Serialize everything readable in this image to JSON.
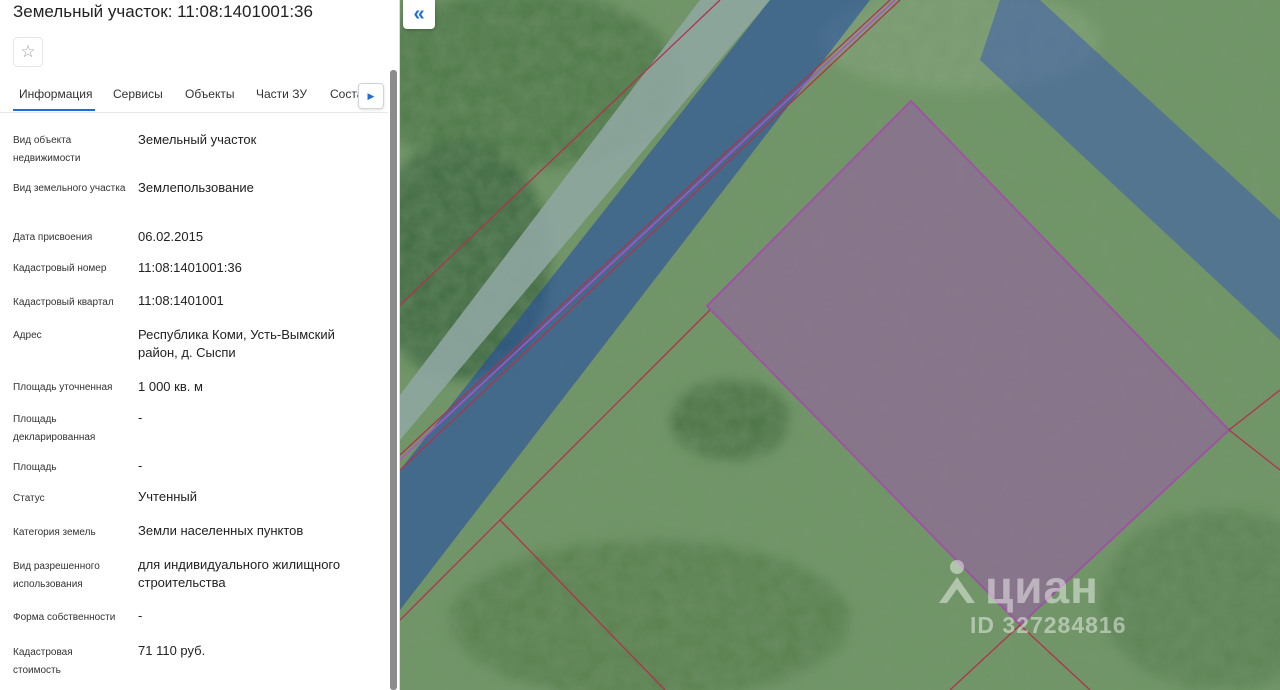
{
  "panel": {
    "title": "Земельный участок: 11:08:1401001:36",
    "favorite_icon": "star-outline-icon",
    "tabs": [
      {
        "label": "Информация",
        "active": true
      },
      {
        "label": "Сервисы",
        "active": false
      },
      {
        "label": "Объекты",
        "active": false
      },
      {
        "label": "Части ЗУ",
        "active": false
      },
      {
        "label": "Соста",
        "active": false
      }
    ],
    "tabs_next_icon": "caret-right-icon",
    "fields": [
      {
        "label": "Вид объекта недвижимости",
        "value": "Земельный участок"
      },
      {
        "label": "Вид земельного участка",
        "value": "Землепользование"
      },
      {
        "label": "Дата присвоения",
        "value": "06.02.2015"
      },
      {
        "label": "Кадастровый номер",
        "value": "11:08:1401001:36"
      },
      {
        "label": "Кадастровый квартал",
        "value": "11:08:1401001"
      },
      {
        "label": "Адрес",
        "value": "Республика Коми, Усть-Вымский район, д. Сыспи"
      },
      {
        "label": "Площадь уточненная",
        "value": "1 000 кв. м"
      },
      {
        "label": "Площадь декларированная",
        "value": "-"
      },
      {
        "label": "Площадь",
        "value": "-"
      },
      {
        "label": "Статус",
        "value": "Учтенный"
      },
      {
        "label": "Категория земель",
        "value": "Земли населенных пунктов"
      },
      {
        "label": "Вид разрешенного использования",
        "value": "для индивидуального жилищного строительства"
      },
      {
        "label": "Форма собственности",
        "value": "-"
      },
      {
        "label": "Кадастровая стоимость",
        "value": "71 110 руб."
      }
    ]
  },
  "map": {
    "collapse_icon": "double-chevron-left-icon",
    "watermark_brand": "циан",
    "watermark_id": "ID 327284816",
    "colors": {
      "accent": "#1f6fd1",
      "parcel_fill": "#8e5a9e",
      "parcel_border": "#c21fd0",
      "zone_fill": "#1f47a8",
      "boundary_line": "#b0334d",
      "grass": "#5f8a5a"
    }
  }
}
